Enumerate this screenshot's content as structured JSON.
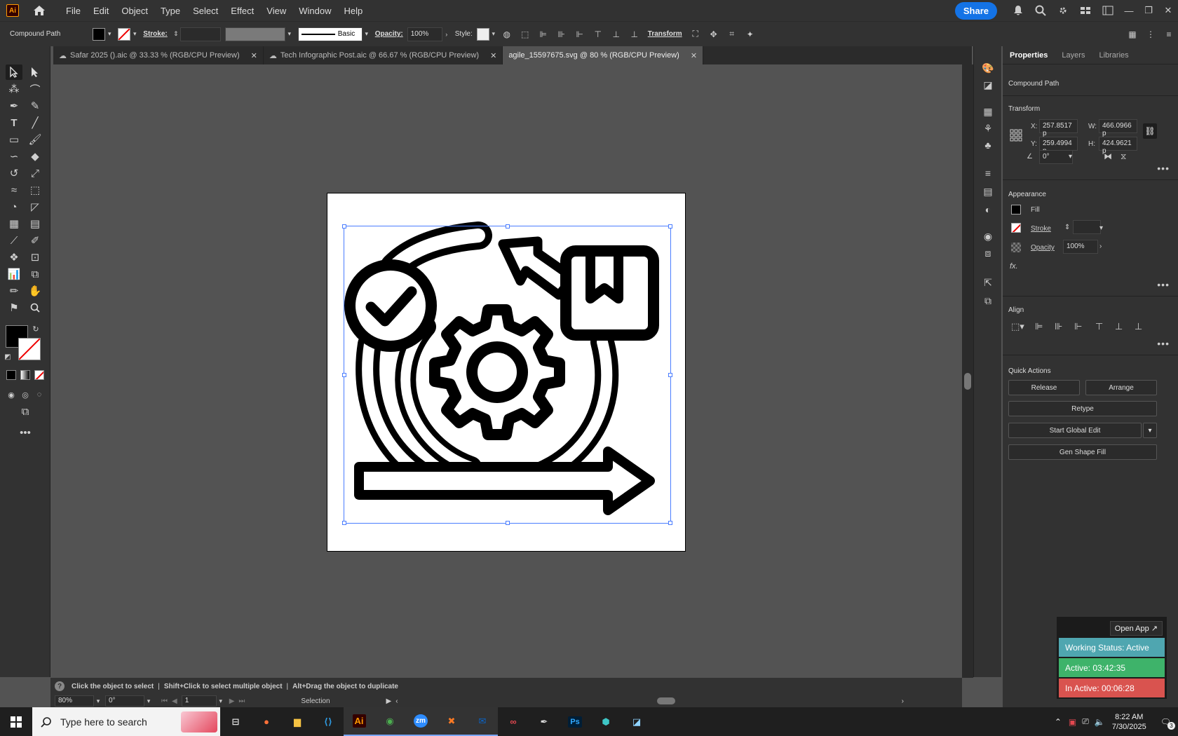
{
  "app": {
    "logo": "Ai",
    "menus": [
      "File",
      "Edit",
      "Object",
      "Type",
      "Select",
      "Effect",
      "View",
      "Window",
      "Help"
    ],
    "share": "Share"
  },
  "control_bar": {
    "object_type": "Compound Path",
    "stroke_label": "Stroke:",
    "brush": "Basic",
    "opacity_label": "Opacity:",
    "opacity_value": "100%",
    "style_label": "Style:",
    "transform": "Transform"
  },
  "tabs": [
    {
      "label": "Safar 2025 ().aic @ 33.33 % (RGB/CPU Preview)"
    },
    {
      "label": "Tech Infographic Post.aic @ 66.67 % (RGB/CPU Preview)"
    },
    {
      "label": "agile_15597675.svg @ 80 % (RGB/CPU Preview)"
    }
  ],
  "properties": {
    "tabs": [
      "Properties",
      "Layers",
      "Libraries"
    ],
    "selection": "Compound Path",
    "transform_title": "Transform",
    "x_label": "X:",
    "x": "257.8517 p",
    "y_label": "Y:",
    "y": "259.4994 p",
    "w_label": "W:",
    "w": "466.0966 p",
    "h_label": "H:",
    "h": "424.9621 p",
    "angle": "0°",
    "appearance_title": "Appearance",
    "fill": "Fill",
    "stroke": "Stroke",
    "opacity_label": "Opacity",
    "opacity": "100%",
    "fx": "fx.",
    "align_title": "Align",
    "quick_title": "Quick Actions",
    "release": "Release",
    "arrange": "Arrange",
    "retype": "Retype",
    "global_edit": "Start Global Edit",
    "gen_fill": "Gen Shape Fill"
  },
  "status": {
    "hint1": "Click the object to select",
    "hint2": "Shift+Click to select multiple object",
    "hint3": "Alt+Drag the object to duplicate",
    "zoom": "80%",
    "rotation": "0°",
    "artboard": "1",
    "tool": "Selection"
  },
  "tracker": {
    "open_app": "Open App ↗",
    "working": "Working Status: Active",
    "active": "Active: 03:42:35",
    "inactive": "In Active: 00:06:28",
    "colors": {
      "working": "#4fa6b0",
      "active": "#3eb36a",
      "inactive": "#d9534f"
    }
  },
  "taskbar": {
    "search": "Type here to search",
    "time": "8:22 AM",
    "date": "7/30/2025",
    "notif": "3",
    "apps": [
      "task-view-icon",
      "firefox-icon",
      "file-explorer-icon",
      "vscode-icon",
      "illustrator-icon",
      "chrome-icon",
      "zoom-icon",
      "xampp-icon",
      "outlook-icon",
      "creative-cloud-icon",
      "pen-icon",
      "photoshop-icon",
      "app-icon",
      "app2-icon"
    ]
  }
}
